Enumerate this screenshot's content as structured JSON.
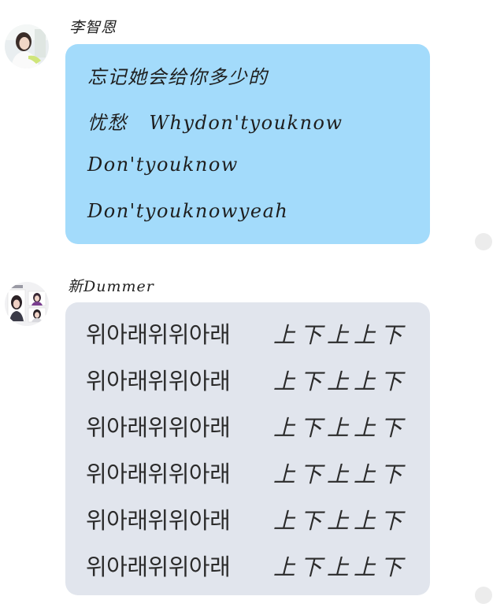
{
  "messages": [
    {
      "sender": "李智恩",
      "avatar": "avatar-woman-white-shirt",
      "bubble_color": "#a3dbfb",
      "lines": [
        "忘记她会给你多少的",
        "忧愁   Whydon'tyouknow",
        "Don'tyouknow",
        "Don'tyouknowyeah"
      ]
    },
    {
      "sender": "新Dummer",
      "avatar": "avatar-collage",
      "bubble_color": "#e1e5ed",
      "lines": [
        {
          "korean": "위아래위위아래",
          "chinese": "上下上上下"
        },
        {
          "korean": "위아래위위아래",
          "chinese": "上下上上下"
        },
        {
          "korean": "위아래위위아래",
          "chinese": "上下上上下"
        },
        {
          "korean": "위아래위위아래",
          "chinese": "上下上上下"
        },
        {
          "korean": "위아래위위아래",
          "chinese": "上下上上下"
        },
        {
          "korean": "위아래위위아래",
          "chinese": "上下上上下"
        }
      ]
    }
  ]
}
